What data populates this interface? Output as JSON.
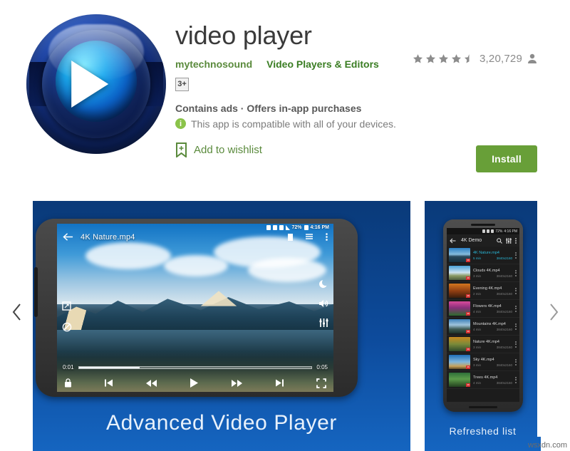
{
  "app": {
    "title": "video player",
    "developer": "mytechnosound",
    "category": "Video Players & Editors",
    "content_rating": "3+",
    "monetization": "Contains ads · Offers in-app purchases",
    "compatibility": "This app is compatible with all of your devices.",
    "info_icon_glyph": "i",
    "wishlist_label": "Add to wishlist",
    "install_label": "Install",
    "rating_count": "3,20,729",
    "stars_filled": 4,
    "stars_half": 1,
    "stars_total": 5
  },
  "colors": {
    "install_green": "#689f38",
    "link_green": "#5a8a3c",
    "category_green": "#3a7d23",
    "panel_blue_top": "#0a3a79",
    "panel_blue_bottom": "#1565c0",
    "accent_cyan": "#29b6d6",
    "title_gray": "#3a3a3a"
  },
  "gallery": {
    "prev_label": "‹",
    "next_label": "›",
    "shot1": {
      "caption": "Advanced Video Player",
      "status_battery": "72%",
      "status_time": "4:16 PM",
      "video_title": "4K Nature.mp4",
      "time_elapsed": "0:01",
      "time_total": "0:05",
      "progress_percent": 26,
      "left_icons": [
        "crop-icon",
        "rotate-lock-icon"
      ],
      "right_icons": [
        "moon-icon",
        "volume-icon",
        "equalizer-icon"
      ],
      "top_icons": [
        "subtitle-icon",
        "playlist-icon",
        "overflow-menu-icon"
      ],
      "transport": [
        "lock-icon",
        "previous-icon",
        "rewind-icon",
        "play-icon",
        "fast-forward-icon",
        "next-icon",
        "fullscreen-icon"
      ]
    },
    "shot2": {
      "caption": "Refreshed list",
      "status_battery": "72%",
      "status_time": "4:16 PM",
      "folder_title": "4K Demo",
      "actions": [
        "search-icon",
        "equalizer-icon",
        "overflow-menu-icon"
      ],
      "items": [
        {
          "name": "4K Nature.mp4",
          "duration": "5 min",
          "resolution": "3840x2160",
          "active": true
        },
        {
          "name": "Clouds 4K.mp4",
          "duration": "3 min",
          "resolution": "3840x2160",
          "active": false
        },
        {
          "name": "Evening 4K.mp4",
          "duration": "2 min",
          "resolution": "3840x2160",
          "active": false
        },
        {
          "name": "Flowers 4K.mp4",
          "duration": "4 min",
          "resolution": "3840x2160",
          "active": false
        },
        {
          "name": "Mountains 4K.mp4",
          "duration": "4 min",
          "resolution": "3840x2160",
          "active": false
        },
        {
          "name": "Nature 4K.mp4",
          "duration": "3 min",
          "resolution": "3840x2160",
          "active": false
        },
        {
          "name": "Sky 4K.mp4",
          "duration": "3 min",
          "resolution": "3840x2160",
          "active": false
        },
        {
          "name": "Trees 4K.mp4",
          "duration": "4 min",
          "resolution": "3840x2160",
          "active": false
        }
      ]
    }
  },
  "watermark": "wsxdn.com"
}
